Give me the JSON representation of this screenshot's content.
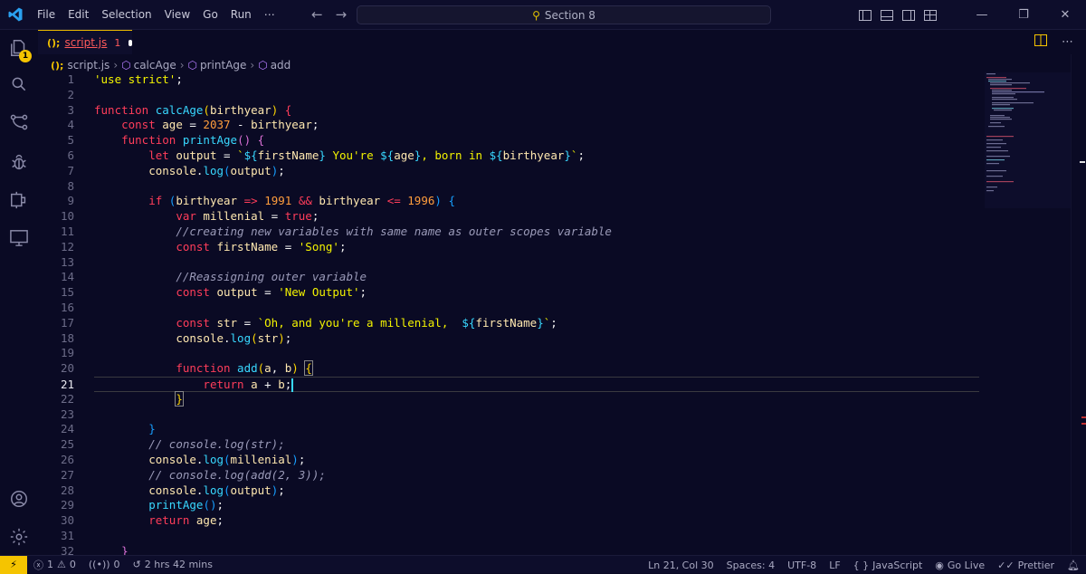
{
  "menu": [
    "File",
    "Edit",
    "Selection",
    "View",
    "Go",
    "Run",
    "⋯"
  ],
  "command_center": {
    "label": "Section 8"
  },
  "activity_bar": {
    "explorer_badge": "1"
  },
  "tab": {
    "icon_text": "(); ",
    "filename": "script.js",
    "problem_count": "1"
  },
  "breadcrumb": {
    "icon_text": "();",
    "file": "script.js",
    "items": [
      "calcAge",
      "printAge",
      "add"
    ]
  },
  "editor": {
    "current_line": 21,
    "lines": [
      [
        [
          "st",
          "'use strict'"
        ],
        [
          "pl",
          ";"
        ]
      ],
      [],
      [
        [
          "kw",
          "function "
        ],
        [
          "fn",
          "calcAge"
        ],
        [
          "br1",
          "("
        ],
        [
          "vr",
          "birthyear"
        ],
        [
          "br1",
          ")"
        ],
        [
          "pl",
          " "
        ],
        [
          "kw",
          "{"
        ]
      ],
      [
        [
          "pl",
          "    "
        ],
        [
          "kw",
          "const "
        ],
        [
          "vr",
          "age"
        ],
        [
          "pl",
          " = "
        ],
        [
          "nm",
          "2037"
        ],
        [
          "pl",
          " - "
        ],
        [
          "vr",
          "birthyear"
        ],
        [
          "pl",
          ";"
        ]
      ],
      [
        [
          "pl",
          "    "
        ],
        [
          "kw",
          "function "
        ],
        [
          "fn",
          "printAge"
        ],
        [
          "br2",
          "()"
        ],
        [
          "pl",
          " "
        ],
        [
          "br2",
          "{"
        ]
      ],
      [
        [
          "pl",
          "        "
        ],
        [
          "kw",
          "let "
        ],
        [
          "vr",
          "output"
        ],
        [
          "pl",
          " = "
        ],
        [
          "st",
          "`"
        ],
        [
          "ip",
          "${"
        ],
        [
          "vr",
          "firstName"
        ],
        [
          "ip",
          "}"
        ],
        [
          "st",
          " You're "
        ],
        [
          "ip",
          "${"
        ],
        [
          "vr",
          "age"
        ],
        [
          "ip",
          "}"
        ],
        [
          "st",
          ", born in "
        ],
        [
          "ip",
          "${"
        ],
        [
          "vr",
          "birthyear"
        ],
        [
          "ip",
          "}"
        ],
        [
          "st",
          "`"
        ],
        [
          "pl",
          ";"
        ]
      ],
      [
        [
          "pl",
          "        "
        ],
        [
          "vr",
          "console"
        ],
        [
          "pl",
          "."
        ],
        [
          "fn",
          "log"
        ],
        [
          "br3",
          "("
        ],
        [
          "vr",
          "output"
        ],
        [
          "br3",
          ")"
        ],
        [
          "pl",
          ";"
        ]
      ],
      [],
      [
        [
          "pl",
          "        "
        ],
        [
          "kw",
          "if "
        ],
        [
          "br3",
          "("
        ],
        [
          "vr",
          "birthyear"
        ],
        [
          "pl",
          " "
        ],
        [
          "kw",
          "=>"
        ],
        [
          "pl",
          " "
        ],
        [
          "nm",
          "1991"
        ],
        [
          "pl",
          " "
        ],
        [
          "kw",
          "&&"
        ],
        [
          "pl",
          " "
        ],
        [
          "vr",
          "birthyear"
        ],
        [
          "pl",
          " "
        ],
        [
          "kw",
          "<="
        ],
        [
          "pl",
          " "
        ],
        [
          "nm",
          "1996"
        ],
        [
          "br3",
          ")"
        ],
        [
          "pl",
          " "
        ],
        [
          "br3",
          "{"
        ]
      ],
      [
        [
          "pl",
          "            "
        ],
        [
          "kw",
          "var "
        ],
        [
          "vr",
          "millenial"
        ],
        [
          "pl",
          " = "
        ],
        [
          "kw",
          "true"
        ],
        [
          "pl",
          ";"
        ]
      ],
      [
        [
          "pl",
          "            "
        ],
        [
          "cm",
          "//creating new variables with same name as outer scopes variable"
        ]
      ],
      [
        [
          "pl",
          "            "
        ],
        [
          "kw",
          "const "
        ],
        [
          "vr",
          "firstName"
        ],
        [
          "pl",
          " = "
        ],
        [
          "st",
          "'Song'"
        ],
        [
          "pl",
          ";"
        ]
      ],
      [],
      [
        [
          "pl",
          "            "
        ],
        [
          "cm",
          "//Reassigning outer variable"
        ]
      ],
      [
        [
          "pl",
          "            "
        ],
        [
          "kw",
          "const "
        ],
        [
          "vr",
          "output"
        ],
        [
          "pl",
          " = "
        ],
        [
          "st",
          "'New Output'"
        ],
        [
          "pl",
          ";"
        ]
      ],
      [],
      [
        [
          "pl",
          "            "
        ],
        [
          "kw",
          "const "
        ],
        [
          "vr",
          "str"
        ],
        [
          "pl",
          " = "
        ],
        [
          "st",
          "`Oh, and you're a millenial,  "
        ],
        [
          "ip",
          "${"
        ],
        [
          "vr",
          "firstName"
        ],
        [
          "ip",
          "}"
        ],
        [
          "st",
          "`"
        ],
        [
          "pl",
          ";"
        ]
      ],
      [
        [
          "pl",
          "            "
        ],
        [
          "vr",
          "console"
        ],
        [
          "pl",
          "."
        ],
        [
          "fn",
          "log"
        ],
        [
          "br1",
          "("
        ],
        [
          "vr",
          "str"
        ],
        [
          "br1",
          ")"
        ],
        [
          "pl",
          ";"
        ]
      ],
      [],
      [
        [
          "pl",
          "            "
        ],
        [
          "kw",
          "function "
        ],
        [
          "fn",
          "add"
        ],
        [
          "br1",
          "("
        ],
        [
          "vr",
          "a"
        ],
        [
          "pl",
          ", "
        ],
        [
          "vr",
          "b"
        ],
        [
          "br1",
          ")"
        ],
        [
          "pl",
          " "
        ],
        [
          "br1 bx",
          "{"
        ]
      ],
      [
        [
          "pl",
          "                "
        ],
        [
          "kw",
          "return "
        ],
        [
          "vr",
          "a"
        ],
        [
          "pl",
          " + "
        ],
        [
          "vr",
          "b"
        ],
        [
          "pl",
          ";"
        ],
        [
          "cursor",
          ""
        ]
      ],
      [
        [
          "pl",
          "            "
        ],
        [
          "br1 bx",
          "}"
        ]
      ],
      [],
      [
        [
          "pl",
          "        "
        ],
        [
          "br3",
          "}"
        ]
      ],
      [
        [
          "pl",
          "        "
        ],
        [
          "cm",
          "// console.log(str);"
        ]
      ],
      [
        [
          "pl",
          "        "
        ],
        [
          "vr",
          "console"
        ],
        [
          "pl",
          "."
        ],
        [
          "fn",
          "log"
        ],
        [
          "br3",
          "("
        ],
        [
          "vr",
          "millenial"
        ],
        [
          "br3",
          ")"
        ],
        [
          "pl",
          ";"
        ]
      ],
      [
        [
          "pl",
          "        "
        ],
        [
          "cm",
          "// console.log(add(2, 3));"
        ]
      ],
      [
        [
          "pl",
          "        "
        ],
        [
          "vr",
          "console"
        ],
        [
          "pl",
          "."
        ],
        [
          "fn",
          "log"
        ],
        [
          "br3",
          "("
        ],
        [
          "vr",
          "output"
        ],
        [
          "br3",
          ")"
        ],
        [
          "pl",
          ";"
        ]
      ],
      [
        [
          "pl",
          "        "
        ],
        [
          "fn",
          "printAge"
        ],
        [
          "br3",
          "()"
        ],
        [
          "pl",
          ";"
        ]
      ],
      [
        [
          "pl",
          "        "
        ],
        [
          "kw",
          "return "
        ],
        [
          "vr",
          "age"
        ],
        [
          "pl",
          ";"
        ]
      ],
      [],
      [
        [
          "pl",
          "    "
        ],
        [
          "br2",
          "}"
        ]
      ]
    ]
  },
  "status": {
    "errors": "1",
    "warnings": "0",
    "ports": "0",
    "time": "2 hrs 42 mins",
    "position": "Ln 21, Col 30",
    "spaces": "Spaces: 4",
    "encoding": "UTF-8",
    "eol": "LF",
    "language": "JavaScript",
    "go_live": "Go Live",
    "prettier": "Prettier"
  },
  "colors": {
    "accent": "#f5c400",
    "keyword": "#ff3d5a",
    "function": "#38d8ff",
    "string": "#f3f300",
    "number": "#ff9d3d",
    "background": "#0a0a24"
  },
  "icons": [
    "vscode-logo-icon",
    "files-icon",
    "search-icon",
    "source-control-icon",
    "debug-icon",
    "extensions-icon",
    "remote-explorer-icon",
    "account-icon",
    "settings-gear-icon"
  ]
}
